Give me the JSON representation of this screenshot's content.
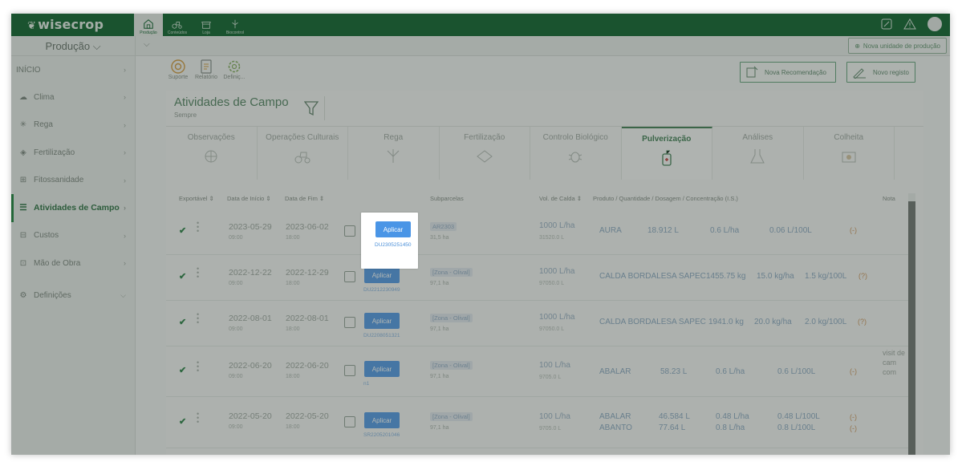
{
  "app": {
    "logo": "wisecrop",
    "user_icon": "user-avatar"
  },
  "topnav": [
    {
      "label": "Produção",
      "icon": "barn-icon",
      "active": true
    },
    {
      "label": "Conteúdos",
      "icon": "tractor-icon",
      "active": false
    },
    {
      "label": "Loja",
      "icon": "shop-icon",
      "active": false
    },
    {
      "label": "Biocontrol",
      "icon": "biocontrol-icon",
      "active": false
    }
  ],
  "subbar": {
    "production_select": "Produção ⌵",
    "new_unit_button": "Nova unidade de produção"
  },
  "sidebar": {
    "items": [
      {
        "label": "INÍCIO"
      },
      {
        "label": "Clima"
      },
      {
        "label": "Rega"
      },
      {
        "label": "Fertilização"
      },
      {
        "label": "Fitossanidade"
      },
      {
        "label": "Atividades de Campo"
      },
      {
        "label": "Custos"
      },
      {
        "label": "Mão de Obra"
      },
      {
        "label": "Definições"
      }
    ]
  },
  "toolbar": {
    "tools": [
      "Suporte",
      "Relatório",
      "Definiç..."
    ],
    "new_recommendation": "Nova Recomendação",
    "new_record": "Novo registo"
  },
  "page": {
    "title": "Atividades de Campo",
    "subtitle": "Sempre"
  },
  "tabs": [
    "Observações",
    "Operações Culturais",
    "Rega",
    "Fertilização",
    "Controlo Biológico",
    "Pulverização",
    "Análises",
    "Colheita"
  ],
  "active_tab": "Pulverização",
  "table": {
    "headers": {
      "exportable": "Exportável ⇕",
      "start": "Data de Início ⇕",
      "end": "Data de Fim ⇕",
      "subparcels": "Subparcelas",
      "volume": "Vol. de Calda ⇕",
      "product": "Produto / Quantidade / Dosagem / Concentração (I.S.)",
      "notes": "Nota"
    },
    "apply_label": "Aplicar",
    "rows": [
      {
        "start": "2023-05-29",
        "start_time": "09:00",
        "end": "2023-06-02",
        "end_time": "18:00",
        "code": "DU2305251450",
        "parcel": "AR2303",
        "area": "31,5 ha",
        "vol": "1000 L/ha",
        "vol_total": "31520.0 L",
        "products": [
          [
            "AURA",
            "18.912 L",
            "0.6 L/ha",
            "0.06 L/100L"
          ]
        ],
        "link": "(-)",
        "note": ""
      },
      {
        "start": "2022-12-22",
        "start_time": "09:00",
        "end": "2022-12-29",
        "end_time": "18:00",
        "code": "DU2212230949",
        "parcel": "[Zona - Olival]",
        "area": "97,1 ha",
        "vol": "1000 L/ha",
        "vol_total": "97050.0 L",
        "products": [
          [
            "CALDA BORDALESA SAPEC",
            "1455.75 kg",
            "15.0 kg/ha",
            "1.5 kg/100L"
          ]
        ],
        "link": "(?)",
        "note": ""
      },
      {
        "start": "2022-08-01",
        "start_time": "09:00",
        "end": "2022-08-01",
        "end_time": "18:00",
        "code": "DU2208051321",
        "parcel": "[Zona - Olival]",
        "area": "97,1 ha",
        "vol": "1000 L/ha",
        "vol_total": "97050.0 L",
        "products": [
          [
            "CALDA BORDALESA SAPEC",
            "1941.0 kg",
            "20.0 kg/ha",
            "2.0 kg/100L"
          ]
        ],
        "link": "(?)",
        "note": ""
      },
      {
        "start": "2022-06-20",
        "start_time": "09:00",
        "end": "2022-06-20",
        "end_time": "18:00",
        "code": "n1",
        "parcel": "[Zona - Olival]",
        "area": "97,1 ha",
        "vol": "100 L/ha",
        "vol_total": "9705.0 L",
        "products": [
          [
            "ABALAR",
            "58.23 L",
            "0.6 L/ha",
            "0.6 L/100L"
          ]
        ],
        "link": "(-)",
        "note": "visit de cam com"
      },
      {
        "start": "2022-05-20",
        "start_time": "09:00",
        "end": "2022-05-20",
        "end_time": "18:00",
        "code": "SR2205201046",
        "parcel": "[Zona - Olival]",
        "area": "97,1 ha",
        "vol": "100 L/ha",
        "vol_total": "9705.0 L",
        "products": [
          [
            "ABALAR",
            "46.584 L",
            "0.48 L/ha",
            "0.48 L/100L"
          ],
          [
            "ABANTO",
            "77.64 L",
            "0.8 L/ha",
            "0.8 L/100L"
          ]
        ],
        "link": "(-)",
        "note": ""
      }
    ]
  },
  "colors": {
    "brand": "#1e6c3b",
    "apply": "#4a95e6",
    "accent": "#4e8760"
  }
}
